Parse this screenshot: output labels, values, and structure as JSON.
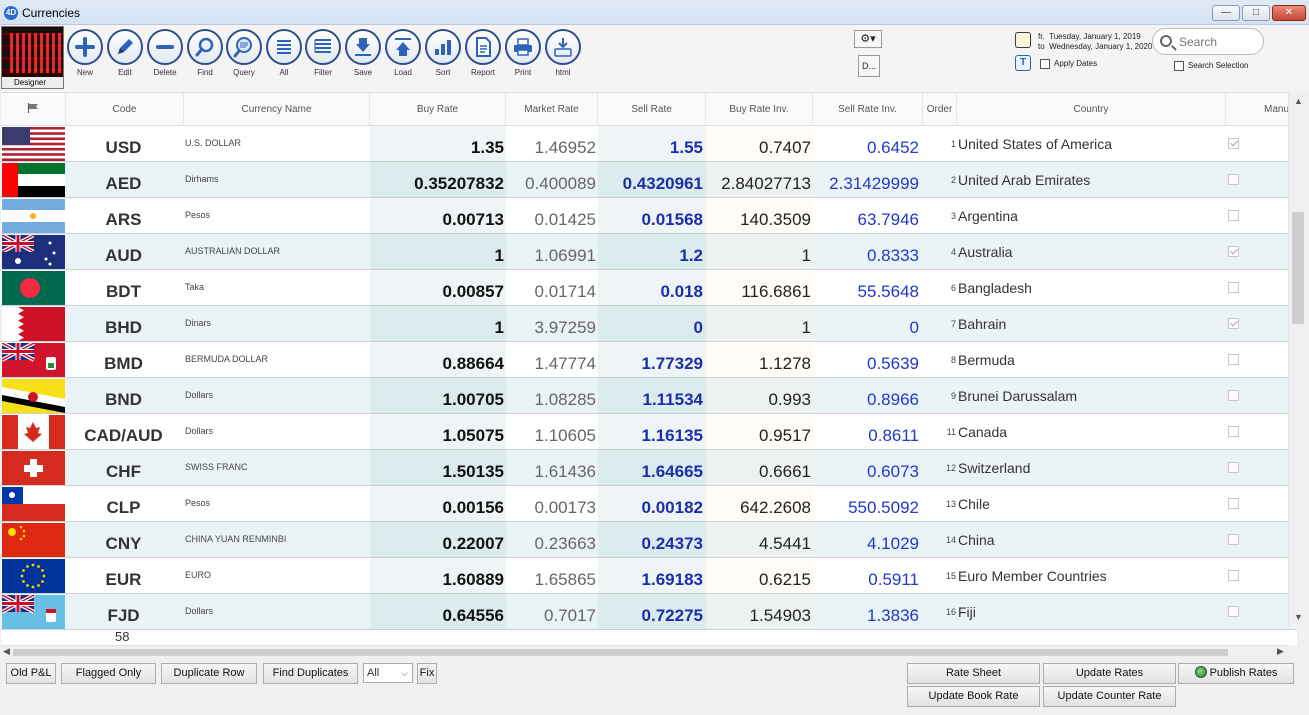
{
  "window": {
    "title": "Currencies"
  },
  "toolbar": {
    "designer_label": "Designer",
    "tools": [
      {
        "id": "new",
        "label": "New",
        "icon": "plus-icon"
      },
      {
        "id": "edit",
        "label": "Edit",
        "icon": "pencil-icon"
      },
      {
        "id": "delete",
        "label": "Delete",
        "icon": "minus-icon"
      },
      {
        "id": "find",
        "label": "Find",
        "icon": "magnifier-icon"
      },
      {
        "id": "query",
        "label": "Query",
        "icon": "query-icon"
      },
      {
        "id": "all",
        "label": "All",
        "icon": "list-icon"
      },
      {
        "id": "filter",
        "label": "Filter",
        "icon": "filter-list-icon"
      },
      {
        "id": "save",
        "label": "Save",
        "icon": "save-icon"
      },
      {
        "id": "load",
        "label": "Load",
        "icon": "load-icon"
      },
      {
        "id": "sort",
        "label": "Sort",
        "icon": "sort-icon"
      },
      {
        "id": "report",
        "label": "Report",
        "icon": "report-icon"
      },
      {
        "id": "print",
        "label": "Print",
        "icon": "printer-icon"
      },
      {
        "id": "html",
        "label": "html",
        "icon": "html-download-icon"
      }
    ],
    "d_button": "D...",
    "date_from_prefix": "fr.",
    "date_from": "Tuesday, January 1, 2019",
    "date_to_prefix": "to",
    "date_to": "Wednesday, January 1, 2020",
    "t_button": "T",
    "apply_dates": "Apply Dates",
    "search_placeholder": "Search",
    "search_selection": "Search Selection"
  },
  "columns": {
    "code": "Code",
    "name": "Currency Name",
    "buy": "Buy Rate",
    "market": "Market Rate",
    "sell": "Sell Rate",
    "buy_inv": "Buy Rate Inv.",
    "sell_inv": "Sell Rate Inv.",
    "order": "Order",
    "country": "Country",
    "manual": "Manu"
  },
  "rows": [
    {
      "flag": "us",
      "code": "USD",
      "name": "U.S. DOLLAR",
      "buy": "1.35",
      "market": "1.46952",
      "sell": "1.55",
      "buy_inv": "0.7407",
      "sell_inv": "0.6452",
      "order": "1",
      "country": "United States of America",
      "manual": true
    },
    {
      "flag": "ae",
      "code": "AED",
      "name": "Dirhams",
      "buy": "0.35207832",
      "market": "0.400089",
      "sell": "0.4320961",
      "buy_inv": "2.84027713",
      "sell_inv": "2.31429999",
      "order": "2",
      "country": "United Arab Emirates",
      "manual": false
    },
    {
      "flag": "ar",
      "code": "ARS",
      "name": "Pesos",
      "buy": "0.00713",
      "market": "0.01425",
      "sell": "0.01568",
      "buy_inv": "140.3509",
      "sell_inv": "63.7946",
      "order": "3",
      "country": "Argentina",
      "manual": false
    },
    {
      "flag": "au",
      "code": "AUD",
      "name": "AUSTRALIAN DOLLAR",
      "buy": "1",
      "market": "1.06991",
      "sell": "1.2",
      "buy_inv": "1",
      "sell_inv": "0.8333",
      "order": "4",
      "country": "Australia",
      "manual": true
    },
    {
      "flag": "bd",
      "code": "BDT",
      "name": "Taka",
      "buy": "0.00857",
      "market": "0.01714",
      "sell": "0.018",
      "buy_inv": "116.6861",
      "sell_inv": "55.5648",
      "order": "6",
      "country": "Bangladesh",
      "manual": false
    },
    {
      "flag": "bh",
      "code": "BHD",
      "name": "Dinars",
      "buy": "1",
      "market": "3.97259",
      "sell": "0",
      "buy_inv": "1",
      "sell_inv": "0",
      "order": "7",
      "country": "Bahrain",
      "manual": true
    },
    {
      "flag": "bm",
      "code": "BMD",
      "name": "BERMUDA DOLLAR",
      "buy": "0.88664",
      "market": "1.47774",
      "sell": "1.77329",
      "buy_inv": "1.1278",
      "sell_inv": "0.5639",
      "order": "8",
      "country": "Bermuda",
      "manual": false
    },
    {
      "flag": "bn",
      "code": "BND",
      "name": "Dollars",
      "buy": "1.00705",
      "market": "1.08285",
      "sell": "1.11534",
      "buy_inv": "0.993",
      "sell_inv": "0.8966",
      "order": "9",
      "country": "Brunei Darussalam",
      "manual": false
    },
    {
      "flag": "ca",
      "code": "CAD/AUD",
      "name": "Dollars",
      "buy": "1.05075",
      "market": "1.10605",
      "sell": "1.16135",
      "buy_inv": "0.9517",
      "sell_inv": "0.8611",
      "order": "11",
      "country": "Canada",
      "manual": false
    },
    {
      "flag": "ch",
      "code": "CHF",
      "name": "SWISS FRANC",
      "buy": "1.50135",
      "market": "1.61436",
      "sell": "1.64665",
      "buy_inv": "0.6661",
      "sell_inv": "0.6073",
      "order": "12",
      "country": "Switzerland",
      "manual": false
    },
    {
      "flag": "cl",
      "code": "CLP",
      "name": "Pesos",
      "buy": "0.00156",
      "market": "0.00173",
      "sell": "0.00182",
      "buy_inv": "642.2608",
      "sell_inv": "550.5092",
      "order": "13",
      "country": "Chile",
      "manual": false
    },
    {
      "flag": "cn",
      "code": "CNY",
      "name": "CHINA YUAN RENMINBI",
      "buy": "0.22007",
      "market": "0.23663",
      "sell": "0.24373",
      "buy_inv": "4.5441",
      "sell_inv": "4.1029",
      "order": "14",
      "country": "China",
      "manual": false
    },
    {
      "flag": "eu",
      "code": "EUR",
      "name": "EURO",
      "buy": "1.60889",
      "market": "1.65865",
      "sell": "1.69183",
      "buy_inv": "0.6215",
      "sell_inv": "0.5911",
      "order": "15",
      "country": "Euro Member Countries",
      "manual": false
    },
    {
      "flag": "fj",
      "code": "FJD",
      "name": "Dollars",
      "buy": "0.64556",
      "market": "0.7017",
      "sell": "0.72275",
      "buy_inv": "1.54903",
      "sell_inv": "1.3836",
      "order": "16",
      "country": "Fiji",
      "manual": false
    }
  ],
  "record_count": "58",
  "bottom": {
    "old_pl": "Old P&L",
    "flagged_only": "Flagged Only",
    "duplicate_row": "Duplicate Row",
    "find_duplicates": "Find Duplicates",
    "filter_select": "All",
    "fix": "Fix",
    "rate_sheet": "Rate Sheet",
    "update_rates": "Update Rates",
    "publish_rates": "Publish Rates",
    "update_book_rate": "Update Book Rate",
    "update_counter_rate": "Update Counter Rate"
  },
  "colors": {
    "sell_text": "#1a2fa8",
    "sell_inv_text": "#2338c8",
    "alt_row": "#eaf4f6",
    "toolbar_ring": "#2f4f8a"
  }
}
